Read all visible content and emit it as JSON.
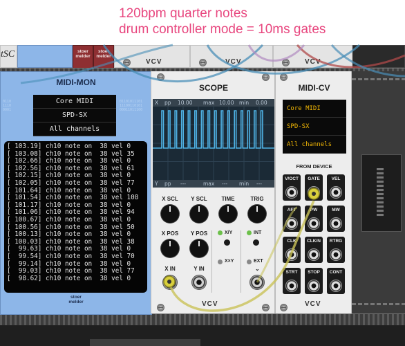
{
  "caption": {
    "line1": "120bpm quarter notes",
    "line2": "drum controller mode = 10ms gates"
  },
  "brand": {
    "stoermelder_top": "stoer",
    "stoermelder_bottom": "melder",
    "vcv": "VCV"
  },
  "midi_mon": {
    "title": "MIDI-MON",
    "driver": "Core MIDI",
    "device": "SPD-SX",
    "channel": "All channels",
    "log": [
      "[ 103.19] ch10 note on  38 vel 0",
      "[ 103.08] ch10 note on  38 vel 35",
      "[ 102.66] ch10 note on  38 vel 0",
      "[ 102.56] ch10 note on  38 vel 61",
      "[ 102.15] ch10 note on  38 vel 0",
      "[ 102.05] ch10 note on  38 vel 77",
      "[ 101.64] ch10 note on  38 vel 0",
      "[ 101.54] ch10 note on  38 vel 108",
      "[ 101.17] ch10 note on  38 vel 0",
      "[ 101.06] ch10 note on  38 vel 94",
      "[ 100.67] ch10 note on  38 vel 0",
      "[ 100.56] ch10 note on  38 vel 50",
      "[ 100.13] ch10 note on  38 vel 0",
      "[ 100.03] ch10 note on  38 vel 38",
      "[  99.63] ch10 note on  38 vel 0",
      "[  99.54] ch10 note on  38 vel 70",
      "[  99.14] ch10 note on  38 vel 0",
      "[  99.03] ch10 note on  38 vel 77",
      "[  98.62] ch10 note on  38 vel 0"
    ]
  },
  "scope": {
    "title": "SCOPE",
    "header_top": {
      "x": "X",
      "pp": "pp",
      "pp_val": "10.00",
      "max": "max",
      "max_val": "10.00",
      "min": "min",
      "min_val": "0.00"
    },
    "header_bottom": {
      "y": "Y",
      "pp": "pp",
      "pp_val": "---",
      "max": "max",
      "max_val": "---",
      "min": "min",
      "min_val": "---"
    },
    "pulse_count": 16,
    "knob_labels": {
      "x_scl": "X SCL",
      "y_scl": "Y SCL",
      "time": "TIME",
      "trig": "TRIG",
      "x_pos": "X POS",
      "y_pos": "Y POS"
    },
    "mode_labels": {
      "xy": "X/Y",
      "x_eq_y": "X×Y",
      "int": "INT",
      "ext": "EXT"
    },
    "jack_labels": {
      "x_in": "X IN",
      "y_in": "Y IN"
    },
    "colors": {
      "trace": "#4fb3e6",
      "led_on": "#6cc04a"
    }
  },
  "midi_cv": {
    "title": "MIDI-CV",
    "driver": "Core MIDI",
    "device": "SPD-SX",
    "channel": "All channels",
    "section": "FROM DEVICE",
    "outputs": [
      "V/OCT",
      "GATE",
      "VEL",
      "AFT",
      "PW",
      "MW",
      "CLK",
      "CLK/N",
      "RTRG",
      "STRT",
      "STOP",
      "CONT"
    ]
  },
  "partial_text": "tSC"
}
